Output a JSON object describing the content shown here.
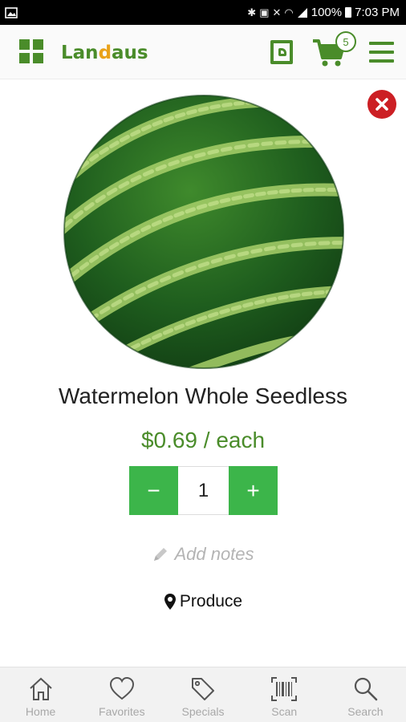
{
  "status_bar": {
    "battery": "100%",
    "time": "7:03 PM"
  },
  "header": {
    "logo_text_1": "Lan",
    "logo_text_accent": "d",
    "logo_text_2": "aus",
    "cart_count": "5"
  },
  "product": {
    "name": "Watermelon Whole Seedless",
    "price": "$0.69 / each",
    "quantity": "1",
    "decrement_label": "−",
    "increment_label": "+",
    "notes_label": "Add notes",
    "category": "Produce"
  },
  "bottom_nav": {
    "items": [
      {
        "label": "Home",
        "icon": "home-icon"
      },
      {
        "label": "Favorites",
        "icon": "heart-icon"
      },
      {
        "label": "Specials",
        "icon": "tag-icon"
      },
      {
        "label": "Scan",
        "icon": "barcode-icon"
      },
      {
        "label": "Search",
        "icon": "search-icon"
      }
    ]
  },
  "colors": {
    "brand_green": "#4a8c2a",
    "button_green": "#3cb54a",
    "close_red": "#cc1f24",
    "logo_accent": "#e9a21a"
  }
}
